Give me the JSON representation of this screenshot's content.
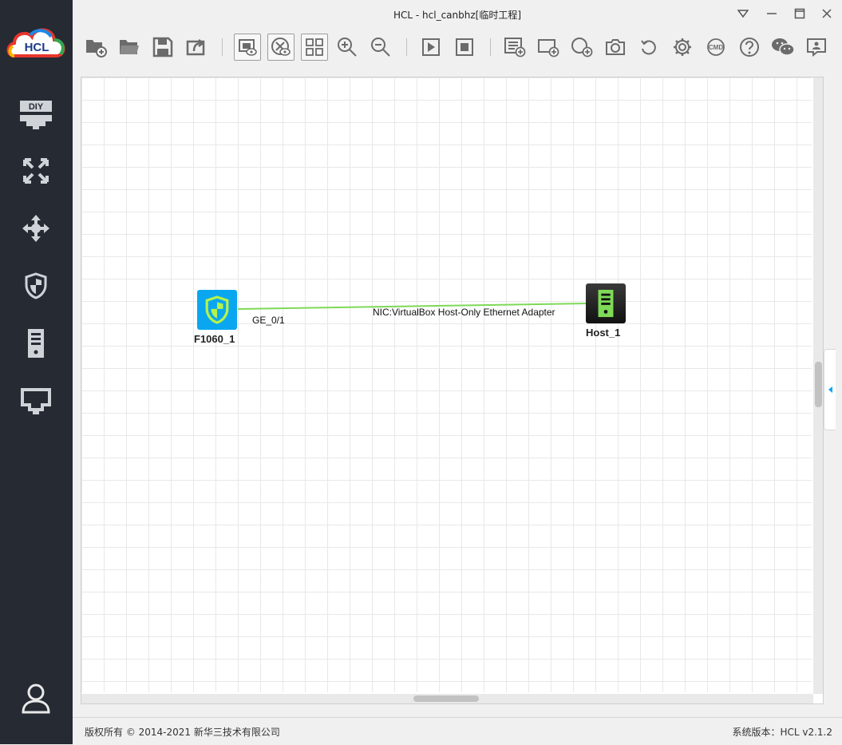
{
  "window": {
    "title": "HCL - hcl_canbhz[临时工程]"
  },
  "logo": {
    "text": "HCL"
  },
  "sidebar": {
    "items": [
      {
        "name": "diy-icon",
        "label": "DIY"
      },
      {
        "name": "router-icon"
      },
      {
        "name": "switch-icon"
      },
      {
        "name": "firewall-icon"
      },
      {
        "name": "server-icon"
      },
      {
        "name": "cloud-interface-icon"
      }
    ]
  },
  "toolbar": {
    "buttons": [
      "new-project-icon",
      "open-project-icon",
      "save-icon",
      "export-icon",
      "show-labels-icon",
      "show-topology-icon",
      "grid-icon",
      "zoom-in-icon",
      "zoom-out-icon",
      "start-all-icon",
      "stop-all-icon",
      "add-text-icon",
      "add-rectangle-icon",
      "add-ellipse-icon",
      "screenshot-icon",
      "undo-icon",
      "settings-icon",
      "cmd-icon",
      "help-icon",
      "wechat-icon",
      "feedback-icon"
    ]
  },
  "topology": {
    "nodes": [
      {
        "id": "firewall",
        "label": "F1060_1",
        "color": "#0aa7f0"
      },
      {
        "id": "host",
        "label": "Host_1",
        "color": "#222222"
      }
    ],
    "link": {
      "color": "#7ed957",
      "port_a": "GE_0/1",
      "port_b": "NIC:VirtualBox Host-Only Ethernet Adapter"
    }
  },
  "status": {
    "copyright": "版权所有 © 2014-2021 新华三技术有限公司",
    "version": "系统版本：HCL v2.1.2"
  }
}
